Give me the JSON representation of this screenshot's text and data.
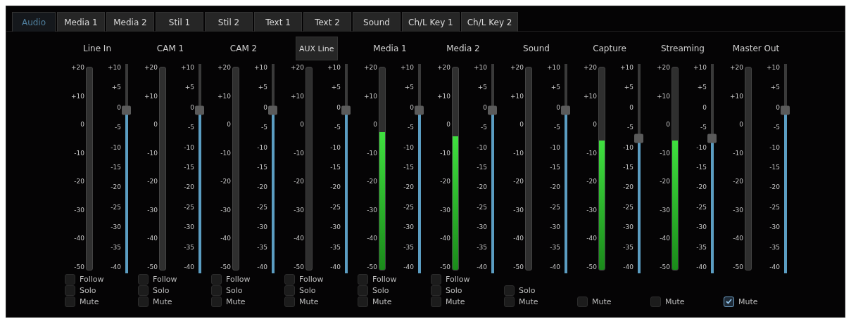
{
  "tabs": [
    {
      "label": "Audio",
      "selected": true
    },
    {
      "label": "Media 1",
      "selected": false
    },
    {
      "label": "Media 2",
      "selected": false
    },
    {
      "label": "Stil 1",
      "selected": false
    },
    {
      "label": "Stil 2",
      "selected": false
    },
    {
      "label": "Text 1",
      "selected": false
    },
    {
      "label": "Text 2",
      "selected": false
    },
    {
      "label": "Sound",
      "selected": false
    },
    {
      "label": "Ch/L Key 1",
      "selected": false
    },
    {
      "label": "Ch/L Key 2",
      "selected": false
    }
  ],
  "channels": [
    {
      "header": {
        "kind": "label",
        "text": "Line In"
      },
      "meter": {
        "ticks": [
          "+20",
          "+10",
          "0",
          "-10",
          "-20",
          "-30",
          "-40",
          "-50"
        ]
      },
      "fader": {
        "level": 0.8,
        "ticks": [
          "+10",
          "+5",
          "0",
          "-5",
          "-10",
          "-15",
          "-20",
          "-25",
          "-30",
          "-35",
          "-40"
        ]
      },
      "options": [
        {
          "label": "Follow",
          "checked": false
        },
        {
          "label": "Solo",
          "checked": false
        },
        {
          "label": "Mute",
          "checked": false
        }
      ]
    },
    {
      "header": {
        "kind": "label",
        "text": "CAM 1"
      },
      "meter": {
        "ticks": [
          "+20",
          "+10",
          "0",
          "-10",
          "-20",
          "-30",
          "-40",
          "-50"
        ]
      },
      "fader": {
        "level": 0.8,
        "ticks": [
          "+10",
          "+5",
          "0",
          "-5",
          "-10",
          "-15",
          "-20",
          "-25",
          "-30",
          "-35",
          "-40"
        ]
      },
      "options": [
        {
          "label": "Follow",
          "checked": false
        },
        {
          "label": "Solo",
          "checked": false
        },
        {
          "label": "Mute",
          "checked": false
        }
      ]
    },
    {
      "header": {
        "kind": "label",
        "text": "CAM 2"
      },
      "meter": {
        "ticks": [
          "+20",
          "+10",
          "0",
          "-10",
          "-20",
          "-30",
          "-40",
          "-50"
        ]
      },
      "fader": {
        "level": 0.8,
        "ticks": [
          "+10",
          "+5",
          "0",
          "-5",
          "-10",
          "-15",
          "-20",
          "-25",
          "-30",
          "-35",
          "-40"
        ]
      },
      "options": [
        {
          "label": "Follow",
          "checked": false
        },
        {
          "label": "Solo",
          "checked": false
        },
        {
          "label": "Mute",
          "checked": false
        }
      ]
    },
    {
      "header": {
        "kind": "dropdown",
        "text": "AUX Line"
      },
      "meter": {
        "ticks": [
          "+20",
          "+10",
          "0",
          "-10",
          "-20",
          "-30",
          "-40",
          "-50"
        ]
      },
      "fader": {
        "level": 0.8,
        "ticks": [
          "+10",
          "+5",
          "0",
          "-5",
          "-10",
          "-15",
          "-20",
          "-25",
          "-30",
          "-35",
          "-40"
        ]
      },
      "options": [
        {
          "label": "Follow",
          "checked": false
        },
        {
          "label": "Solo",
          "checked": false
        },
        {
          "label": "Mute",
          "checked": false
        }
      ]
    },
    {
      "header": {
        "kind": "label",
        "text": "Media 1"
      },
      "meter": {
        "level": 0.68,
        "ticks": [
          "+20",
          "+10",
          "0",
          "-10",
          "-20",
          "-30",
          "-40",
          "-50"
        ]
      },
      "fader": {
        "level": 0.8,
        "ticks": [
          "+10",
          "+5",
          "0",
          "-5",
          "-10",
          "-15",
          "-20",
          "-25",
          "-30",
          "-35",
          "-40"
        ]
      },
      "options": [
        {
          "label": "Follow",
          "checked": false
        },
        {
          "label": "Solo",
          "checked": false
        },
        {
          "label": "Mute",
          "checked": false
        }
      ]
    },
    {
      "header": {
        "kind": "label",
        "text": "Media 2"
      },
      "meter": {
        "level": 0.66,
        "ticks": [
          "+20",
          "+10",
          "0",
          "-10",
          "-20",
          "-30",
          "-40",
          "-50"
        ]
      },
      "fader": {
        "level": 0.8,
        "ticks": [
          "+10",
          "+5",
          "0",
          "-5",
          "-10",
          "-15",
          "-20",
          "-25",
          "-30",
          "-35",
          "-40"
        ]
      },
      "options": [
        {
          "label": "Follow",
          "checked": false
        },
        {
          "label": "Solo",
          "checked": false
        },
        {
          "label": "Mute",
          "checked": false
        }
      ]
    },
    {
      "header": {
        "kind": "label",
        "text": "Sound"
      },
      "meter": {
        "ticks": [
          "+20",
          "+10",
          "0",
          "-10",
          "-20",
          "-30",
          "-40",
          "-50"
        ]
      },
      "fader": {
        "level": 0.8,
        "ticks": [
          "+10",
          "+5",
          "0",
          "-5",
          "-10",
          "-15",
          "-20",
          "-25",
          "-30",
          "-35",
          "-40"
        ]
      },
      "options": [
        {
          "label": "Solo",
          "checked": false
        },
        {
          "label": "Mute",
          "checked": false
        }
      ]
    },
    {
      "header": {
        "kind": "label",
        "text": "Capture"
      },
      "meter": {
        "level": 0.64,
        "ticks": [
          "+20",
          "+10",
          "0",
          "-10",
          "-20",
          "-30",
          "-40",
          "-50"
        ]
      },
      "fader": {
        "level": 0.66,
        "ticks": [
          "+10",
          "+5",
          "0",
          "-5",
          "-10",
          "-15",
          "-20",
          "-25",
          "-30",
          "-35",
          "-40"
        ]
      },
      "options": [
        {
          "label": "Mute",
          "checked": false
        }
      ]
    },
    {
      "header": {
        "kind": "label",
        "text": "Streaming"
      },
      "meter": {
        "level": 0.64,
        "ticks": [
          "+20",
          "+10",
          "0",
          "-10",
          "-20",
          "-30",
          "-40",
          "-50"
        ]
      },
      "fader": {
        "level": 0.66,
        "ticks": [
          "+10",
          "+5",
          "0",
          "-5",
          "-10",
          "-15",
          "-20",
          "-25",
          "-30",
          "-35",
          "-40"
        ]
      },
      "options": [
        {
          "label": "Mute",
          "checked": false
        }
      ]
    },
    {
      "header": {
        "kind": "label",
        "text": "Master Out"
      },
      "meter": {
        "ticks": [
          "+20",
          "+10",
          "0",
          "-10",
          "-20",
          "-30",
          "-40",
          "-50"
        ]
      },
      "fader": {
        "level": 0.8,
        "ticks": [
          "+10",
          "+5",
          "0",
          "-5",
          "-10",
          "-15",
          "-20",
          "-25",
          "-30",
          "-35",
          "-40"
        ]
      },
      "options": [
        {
          "label": "Mute",
          "checked": true
        }
      ]
    }
  ]
}
